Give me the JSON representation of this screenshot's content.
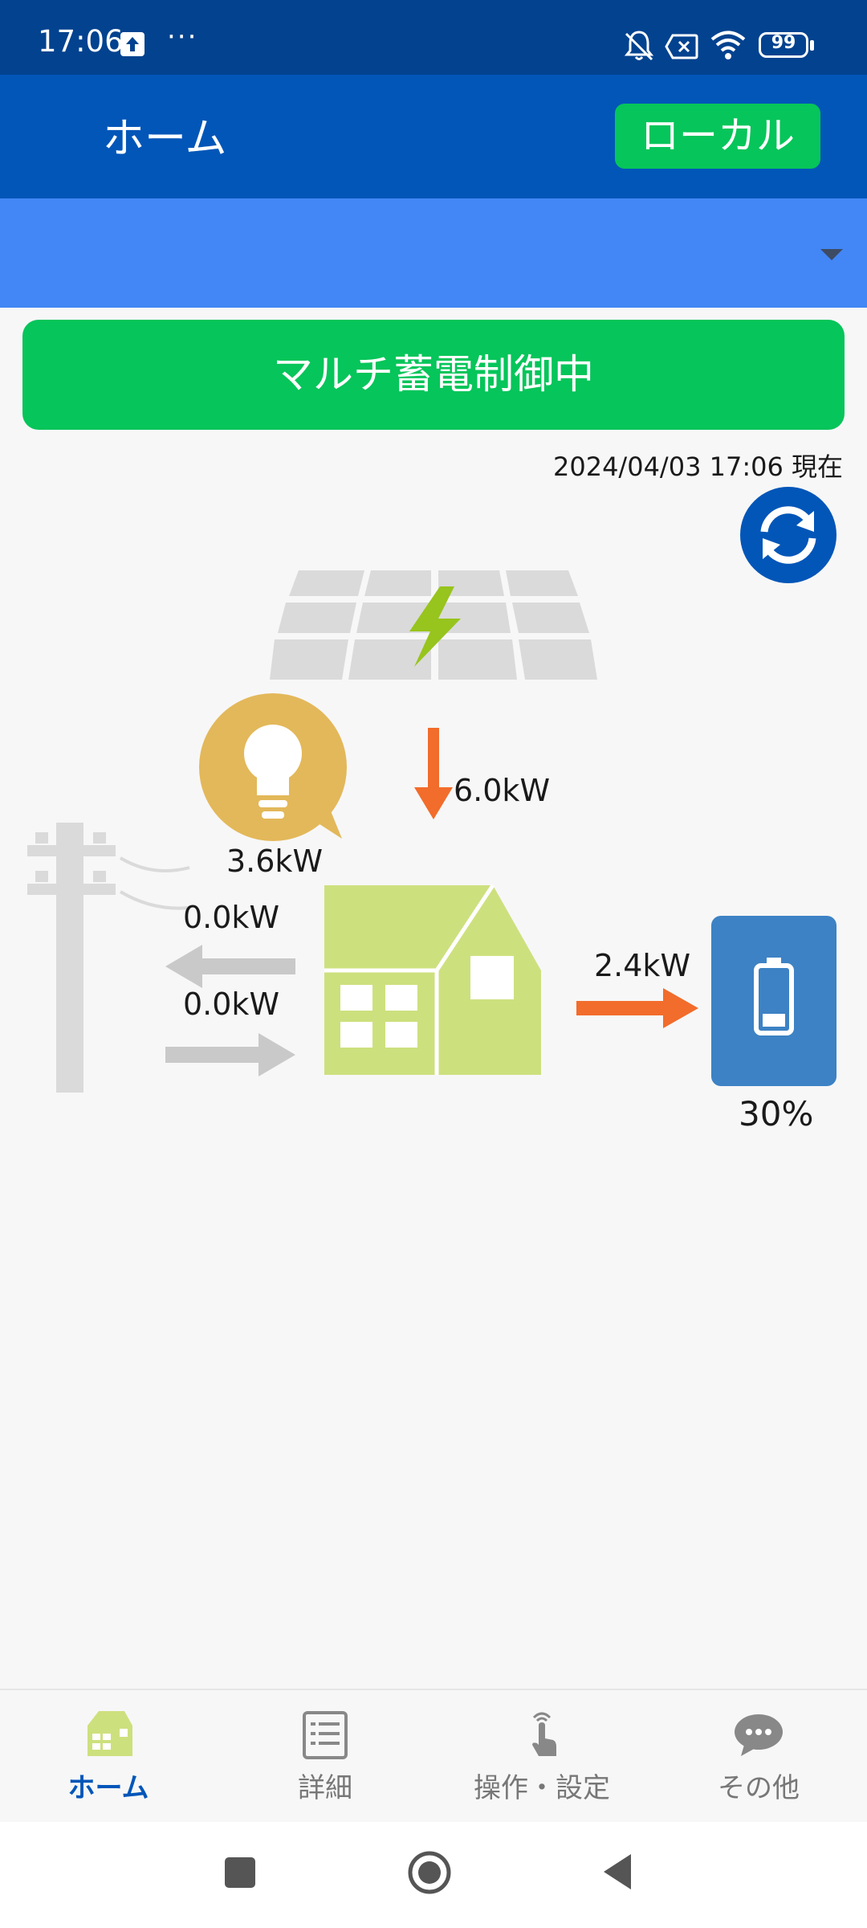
{
  "status_bar": {
    "time": "17:06",
    "dots": "···",
    "battery": "99",
    "icons": [
      "upload-icon",
      "bell-muted-icon",
      "sim-disabled-icon",
      "wifi-icon",
      "battery-icon"
    ]
  },
  "header": {
    "title": "ホーム",
    "local_button": "ローカル"
  },
  "selector": {
    "icon": "chevron-down-icon"
  },
  "banner": {
    "text": "マルチ蓄電制御中"
  },
  "timestamp": "2024/04/03 17:06 現在",
  "flows": {
    "solar": "6.0kW",
    "consumption": "3.6kW",
    "grid_sell": "0.0kW",
    "grid_buy": "0.0kW",
    "battery_charge": "2.4kW",
    "battery_level": "30%"
  },
  "colors": {
    "header": "#0256b8",
    "accent_green": "#06c55a",
    "flow_active": "#f26c2b",
    "flow_inactive": "#c9c9c9",
    "house": "#cde07e",
    "battery": "#3d82c4",
    "bulb": "#e3b85a"
  },
  "bottom_nav": {
    "items": [
      {
        "label": "ホーム",
        "icon": "home-icon"
      },
      {
        "label": "詳細",
        "icon": "list-icon"
      },
      {
        "label": "操作・設定",
        "icon": "touch-icon"
      },
      {
        "label": "その他",
        "icon": "chat-icon"
      }
    ]
  }
}
